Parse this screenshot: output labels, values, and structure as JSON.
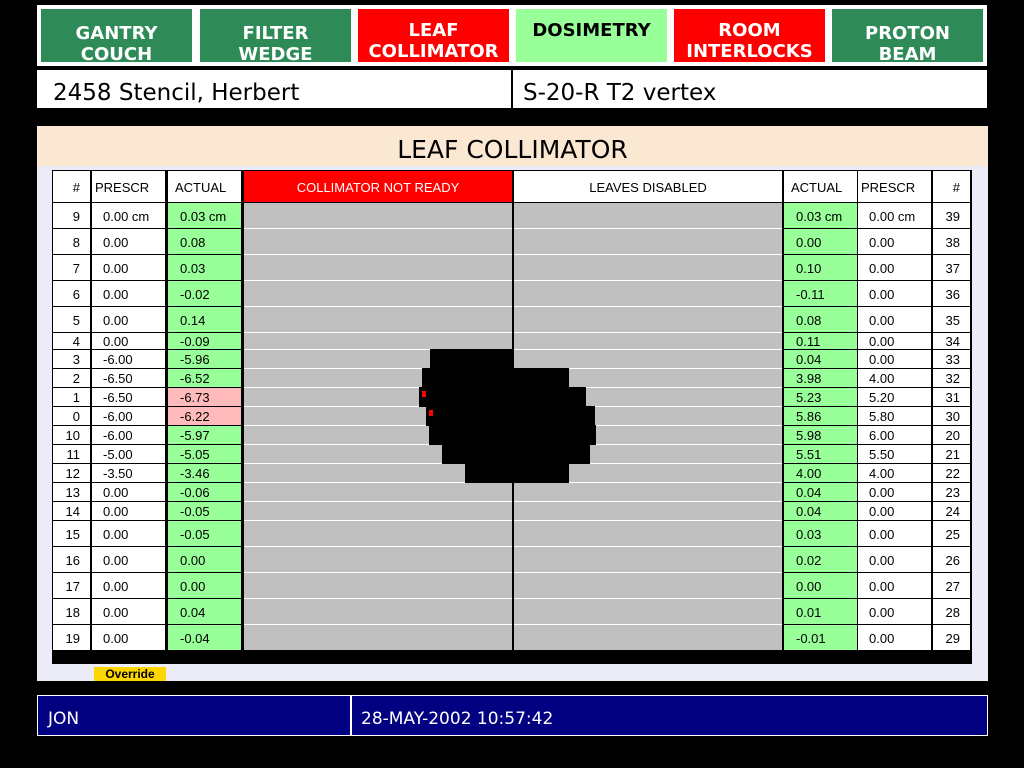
{
  "tabs": [
    {
      "line1": "GANTRY",
      "line2": "COUCH",
      "state": "green"
    },
    {
      "line1": "FILTER",
      "line2": "WEDGE",
      "state": "green"
    },
    {
      "line1": "LEAF",
      "line2": "COLLIMATOR",
      "state": "red"
    },
    {
      "line1": "DOSIMETRY",
      "line2": "",
      "state": "light"
    },
    {
      "line1": "ROOM",
      "line2": "INTERLOCKS",
      "state": "red"
    },
    {
      "line1": "PROTON",
      "line2": "BEAM",
      "state": "green"
    }
  ],
  "patient": {
    "name": "2458 Stencil, Herbert",
    "field": "S-20-R T2 vertex"
  },
  "panel": {
    "title": "LEAF COLLIMATOR"
  },
  "table": {
    "headers": {
      "num": "#",
      "prescr": "PRESCR",
      "actual": "ACTUAL",
      "status_left": "COLLIMATOR NOT READY",
      "status_right": "LEAVES DISABLED",
      "r_actual": "ACTUAL",
      "r_prescr": "PRESCR",
      "r_num": "#"
    },
    "rows": [
      {
        "ln": "9",
        "lp": "0.00 cm",
        "la": "0.03 cm",
        "la_flag": false,
        "ra": "0.03 cm",
        "rp": "0.00 cm",
        "rn": "39"
      },
      {
        "ln": "8",
        "lp": "0.00",
        "la": "0.08",
        "la_flag": false,
        "ra": "0.00",
        "rp": "0.00",
        "rn": "38"
      },
      {
        "ln": "7",
        "lp": "0.00",
        "la": "0.03",
        "la_flag": false,
        "ra": "0.10",
        "rp": "0.00",
        "rn": "37"
      },
      {
        "ln": "6",
        "lp": "0.00",
        "la": "-0.02",
        "la_flag": false,
        "ra": "-0.11",
        "rp": "0.00",
        "rn": "36"
      },
      {
        "ln": "5",
        "lp": "0.00",
        "la": "0.14",
        "la_flag": false,
        "ra": "0.08",
        "rp": "0.00",
        "rn": "35"
      },
      {
        "ln": "4",
        "lp": "0.00",
        "la": "-0.09",
        "la_flag": false,
        "ra": "0.11",
        "rp": "0.00",
        "rn": "34"
      },
      {
        "ln": "3",
        "lp": "-6.00",
        "la": "-5.96",
        "la_flag": false,
        "ra": "0.04",
        "rp": "0.00",
        "rn": "33"
      },
      {
        "ln": "2",
        "lp": "-6.50",
        "la": "-6.52",
        "la_flag": false,
        "ra": "3.98",
        "rp": "4.00",
        "rn": "32"
      },
      {
        "ln": "1",
        "lp": "-6.50",
        "la": "-6.73",
        "la_flag": true,
        "ra": "5.23",
        "rp": "5.20",
        "rn": "31"
      },
      {
        "ln": "0",
        "lp": "-6.00",
        "la": "-6.22",
        "la_flag": true,
        "ra": "5.86",
        "rp": "5.80",
        "rn": "30"
      },
      {
        "ln": "10",
        "lp": "-6.00",
        "la": "-5.97",
        "la_flag": false,
        "ra": "5.98",
        "rp": "6.00",
        "rn": "20"
      },
      {
        "ln": "11",
        "lp": "-5.00",
        "la": "-5.05",
        "la_flag": false,
        "ra": "5.51",
        "rp": "5.50",
        "rn": "21"
      },
      {
        "ln": "12",
        "lp": "-3.50",
        "la": "-3.46",
        "la_flag": false,
        "ra": "4.00",
        "rp": "4.00",
        "rn": "22"
      },
      {
        "ln": "13",
        "lp": "0.00",
        "la": "-0.06",
        "la_flag": false,
        "ra": "0.04",
        "rp": "0.00",
        "rn": "23"
      },
      {
        "ln": "14",
        "lp": "0.00",
        "la": "-0.05",
        "la_flag": false,
        "ra": "0.04",
        "rp": "0.00",
        "rn": "24"
      },
      {
        "ln": "15",
        "lp": "0.00",
        "la": "-0.05",
        "la_flag": false,
        "ra": "0.03",
        "rp": "0.00",
        "rn": "25"
      },
      {
        "ln": "16",
        "lp": "0.00",
        "la": "0.00",
        "la_flag": false,
        "ra": "0.02",
        "rp": "0.00",
        "rn": "26"
      },
      {
        "ln": "17",
        "lp": "0.00",
        "la": "0.00",
        "la_flag": false,
        "ra": "0.00",
        "rp": "0.00",
        "rn": "27"
      },
      {
        "ln": "18",
        "lp": "0.00",
        "la": "0.04",
        "la_flag": false,
        "ra": "0.01",
        "rp": "0.00",
        "rn": "28"
      },
      {
        "ln": "19",
        "lp": "0.00",
        "la": "-0.04",
        "la_flag": false,
        "ra": "-0.01",
        "rp": "0.00",
        "rn": "29"
      }
    ]
  },
  "override_label": "Override",
  "status": {
    "operator": "JON",
    "datetime": "28-MAY-2002 10:57:42"
  }
}
